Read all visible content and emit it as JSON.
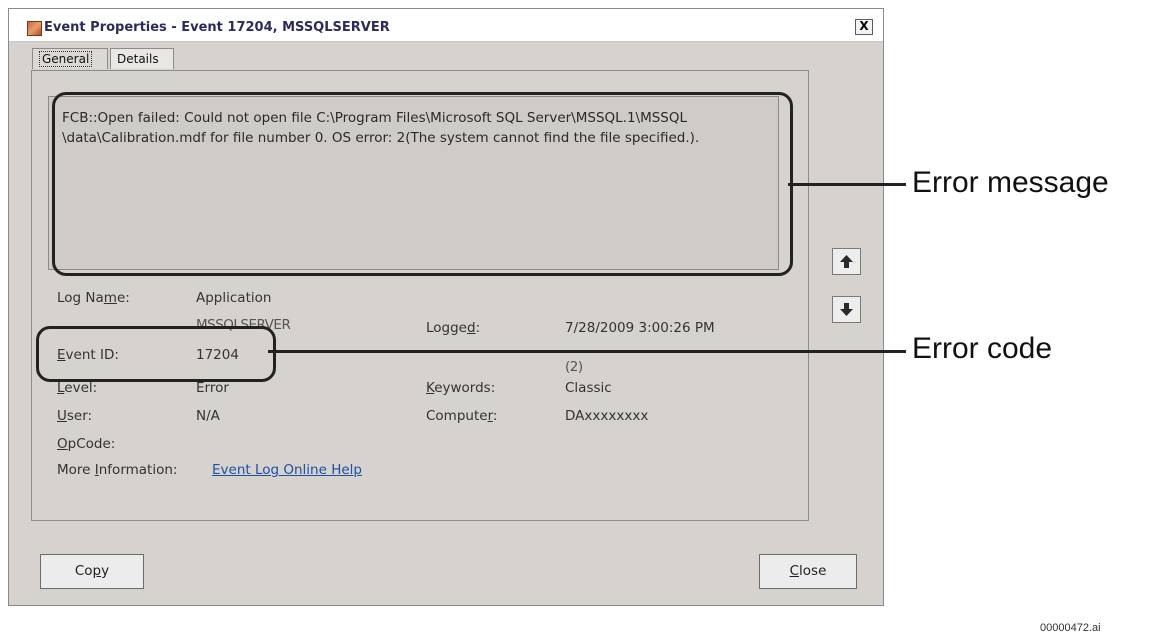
{
  "window": {
    "title": "Event Properties - Event 17204, MSSQLSERVER",
    "close_glyph": "X"
  },
  "tabs": [
    {
      "label": "General",
      "active": true
    },
    {
      "label": "Details",
      "active": false
    }
  ],
  "message": {
    "line1": "FCB::Open failed: Could not open file C:\\Program Files\\Microsoft SQL Server\\MSSQL.1\\MSSQL",
    "line2": "\\data\\Calibration.mdf for file number 0.  OS error: 2(The system cannot find the file specified.)."
  },
  "fields": {
    "log_name_label_pre": "Log Na",
    "log_name_label_ul": "m",
    "log_name_label_post": "e:",
    "log_name_value": "Application",
    "source_value": "MSSQLSERVER",
    "logged_label_pre": "Logge",
    "logged_label_ul": "d",
    "logged_label_post": ":",
    "logged_value": "7/28/2009 3:00:26 PM",
    "event_id_label_ul": "E",
    "event_id_label_post": "vent ID:",
    "event_id_value": "17204",
    "task_category_value": "(2)",
    "level_label_ul": "L",
    "level_label_post": "evel:",
    "level_value": "Error",
    "keywords_label_ul": "K",
    "keywords_label_post": "eywords:",
    "keywords_value": "Classic",
    "user_label_ul": "U",
    "user_label_post": "ser:",
    "user_value": "N/A",
    "computer_label_pre": "Compute",
    "computer_label_ul": "r",
    "computer_label_post": ":",
    "computer_value": "DAxxxxxxxx",
    "opcode_label_ul": "O",
    "opcode_label_post": "pCode:",
    "more_info_label_pre": "More ",
    "more_info_label_ul": "I",
    "more_info_label_post": "nformation:",
    "more_info_link": "Event Log Online Help"
  },
  "buttons": {
    "copy_pre": "Co",
    "copy_ul": "p",
    "copy_post": "y",
    "close_ul": "C",
    "close_post": "lose"
  },
  "callouts": {
    "error_message": "Error message",
    "error_code": "Error code"
  },
  "footer_code": "00000472.ai",
  "icons": [
    "event-log-icon",
    "close-icon",
    "arrow-up-icon",
    "arrow-down-icon"
  ]
}
